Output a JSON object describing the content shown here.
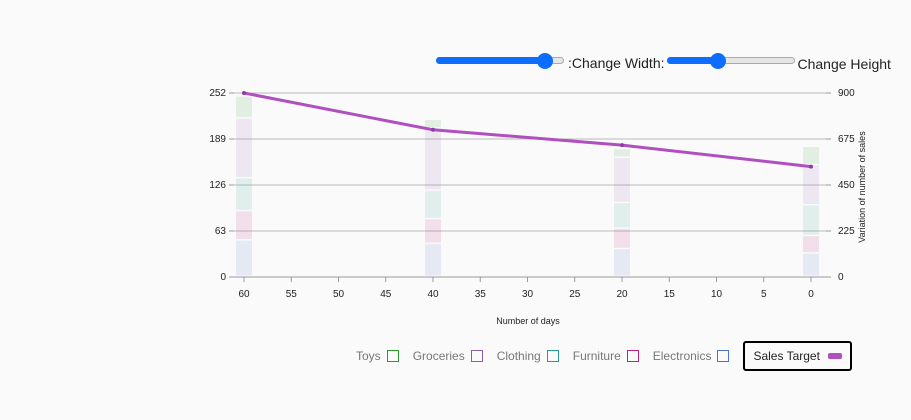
{
  "controls": {
    "width_label": ":Change Width:",
    "height_label": "Change Height",
    "width_value": 0.85,
    "height_value": 0.4
  },
  "legend": {
    "items": [
      {
        "name": "Toys",
        "color": "#2e9a2e"
      },
      {
        "name": "Groceries",
        "color": "#8a5fb0"
      },
      {
        "name": "Clothing",
        "color": "#2a9a8e"
      },
      {
        "name": "Furniture",
        "color": "#c0247a"
      },
      {
        "name": "Electronics",
        "color": "#4f70c8"
      }
    ],
    "line_item": {
      "name": "Sales Target",
      "color": "#b04fc0"
    }
  },
  "chart_data": {
    "type": "bar",
    "stacked": true,
    "x": [
      60,
      40,
      20,
      0
    ],
    "x_ticks": [
      60,
      55,
      50,
      45,
      40,
      35,
      30,
      25,
      20,
      15,
      10,
      5,
      0
    ],
    "xlabel": "Number of days",
    "ylabel": "",
    "y2label": "Variation of number of sales",
    "ylim": [
      0,
      252
    ],
    "y_ticks": [
      0,
      63,
      126,
      189,
      252
    ],
    "y2lim": [
      0,
      900
    ],
    "y2_ticks": [
      0,
      225,
      450,
      675,
      900
    ],
    "grid": true,
    "series": [
      {
        "name": "Electronics",
        "values": [
          50,
          45,
          38,
          32
        ],
        "color": "#4f70c8"
      },
      {
        "name": "Furniture",
        "values": [
          40,
          34,
          28,
          24
        ],
        "color": "#c0247a"
      },
      {
        "name": "Clothing",
        "values": [
          45,
          39,
          35,
          42
        ],
        "color": "#2a9a8e"
      },
      {
        "name": "Groceries",
        "values": [
          82,
          85,
          62,
          55
        ],
        "color": "#8a5fb0"
      },
      {
        "name": "Toys",
        "values": [
          30,
          12,
          12,
          25
        ],
        "color": "#2e9a2e"
      }
    ],
    "line_series": {
      "name": "Sales Target",
      "axis": "right",
      "values": [
        900,
        720,
        645,
        540
      ],
      "color": "#b04fc0"
    }
  }
}
